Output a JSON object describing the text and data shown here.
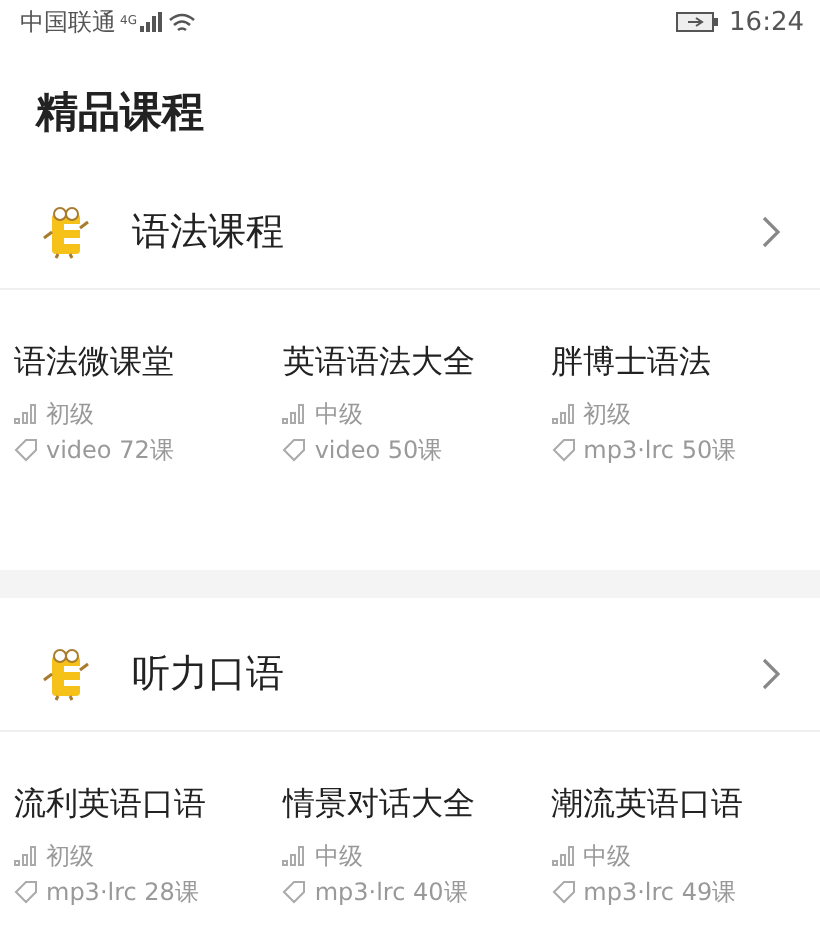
{
  "status_bar": {
    "carrier": "中国联通",
    "network": "4G",
    "time": "16:24"
  },
  "title": "精品课程",
  "sections": [
    {
      "name": "语法课程",
      "courses": [
        {
          "title": "语法微课堂",
          "level": "初级",
          "media": "video 72课"
        },
        {
          "title": "英语语法大全",
          "level": "中级",
          "media": "video 50课"
        },
        {
          "title": "胖博士语法",
          "level": "初级",
          "media": "mp3·lrc 50课"
        }
      ]
    },
    {
      "name": "听力口语",
      "courses": [
        {
          "title": "流利英语口语",
          "level": "初级",
          "media": "mp3·lrc 28课"
        },
        {
          "title": "情景对话大全",
          "level": "中级",
          "media": "mp3·lrc 40课"
        },
        {
          "title": "潮流英语口语",
          "level": "中级",
          "media": "mp3·lrc 49课"
        }
      ]
    }
  ]
}
